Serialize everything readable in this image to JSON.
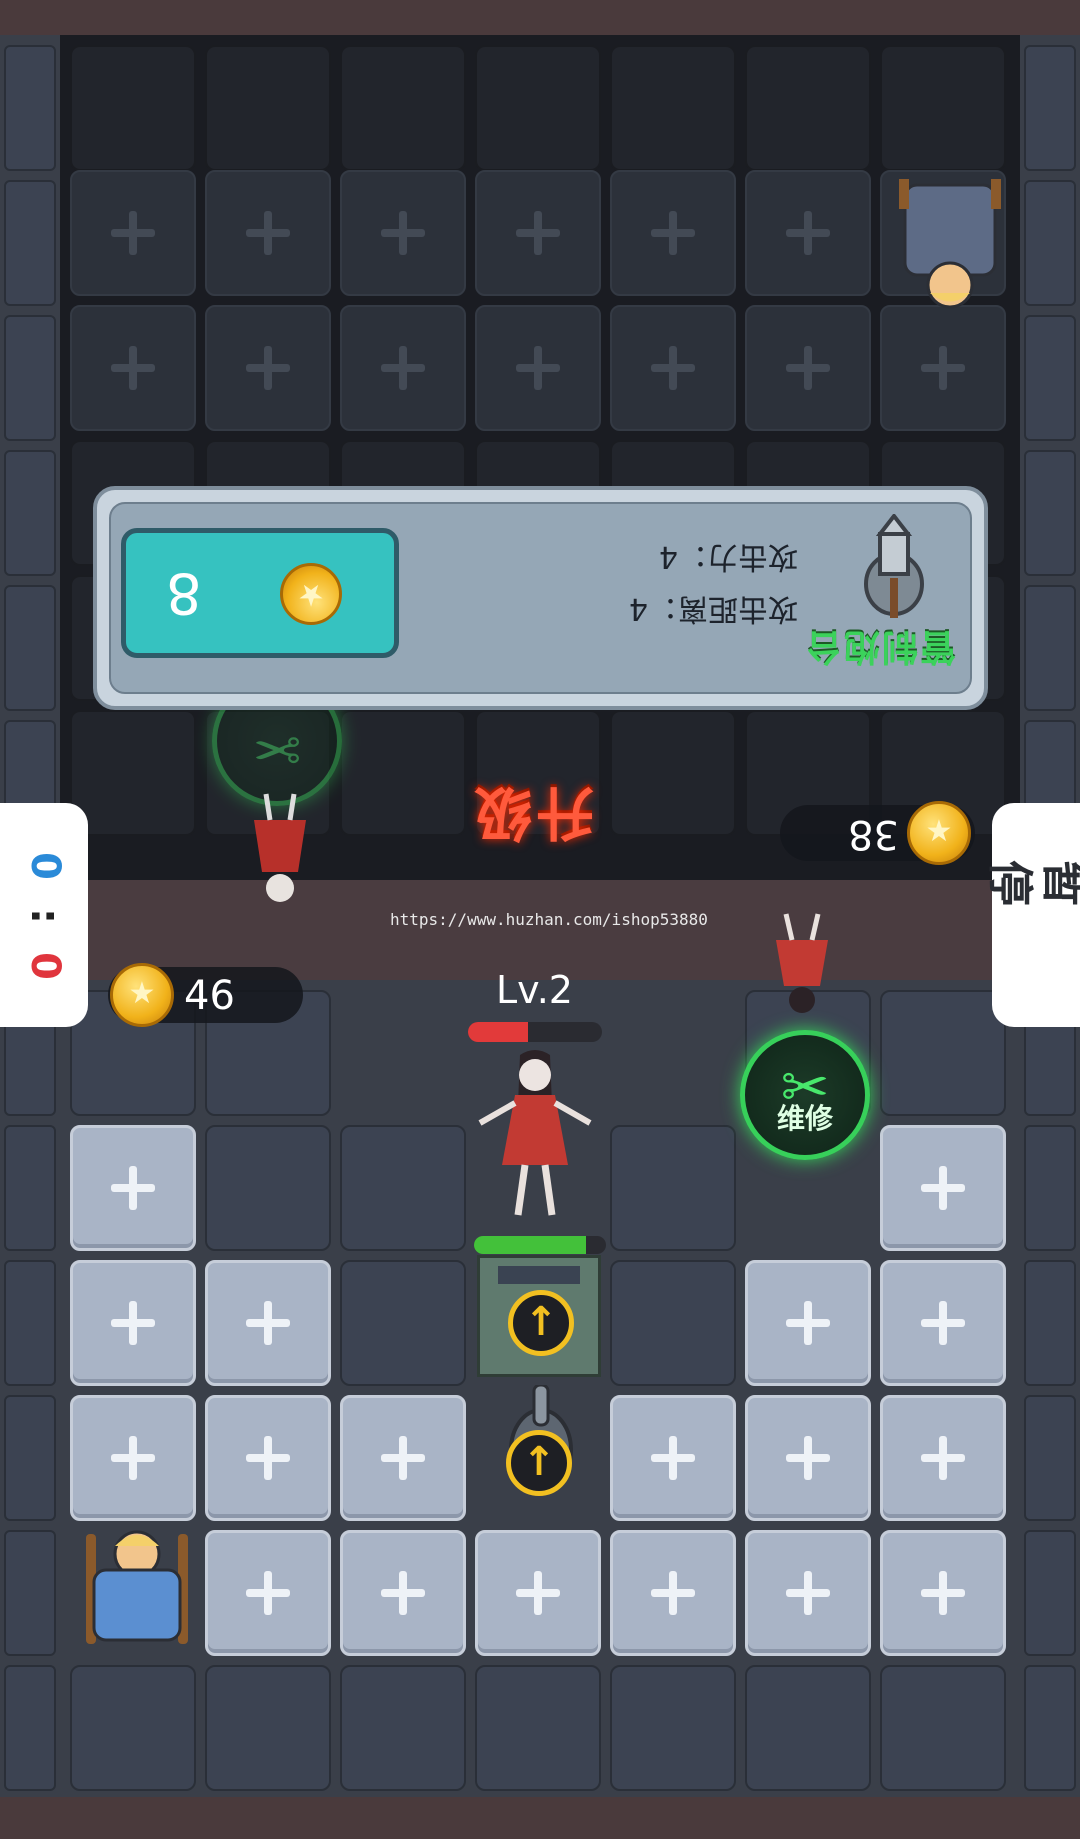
{
  "score": {
    "left": "0",
    "sep": ":",
    "right": "0"
  },
  "pause_label": "暂停",
  "gold": {
    "player": "46",
    "enemy": "38"
  },
  "panel": {
    "name": "管制炮台",
    "attack_power": "攻击力：4",
    "attack_range": "攻击距离：4",
    "cost": "8"
  },
  "upgrade_label": "升级",
  "level_label": "Lv.2",
  "ghost_hp_fraction": 0.45,
  "door_hp_fraction": 0.85,
  "repair_label": "维修",
  "watermark": "https://www.huzhan.com/ishop53880",
  "icons": [
    "coin-icon",
    "upgrade-arrow-icon",
    "repair-wrench-icon",
    "turret-icon",
    "bed-icon",
    "ghost-icon"
  ],
  "colors": {
    "accent_green": "#37d05a",
    "coin_gold": "#f1b21a",
    "panel_teal": "#36c2c0",
    "upgrade_red": "#ff5a3c"
  }
}
